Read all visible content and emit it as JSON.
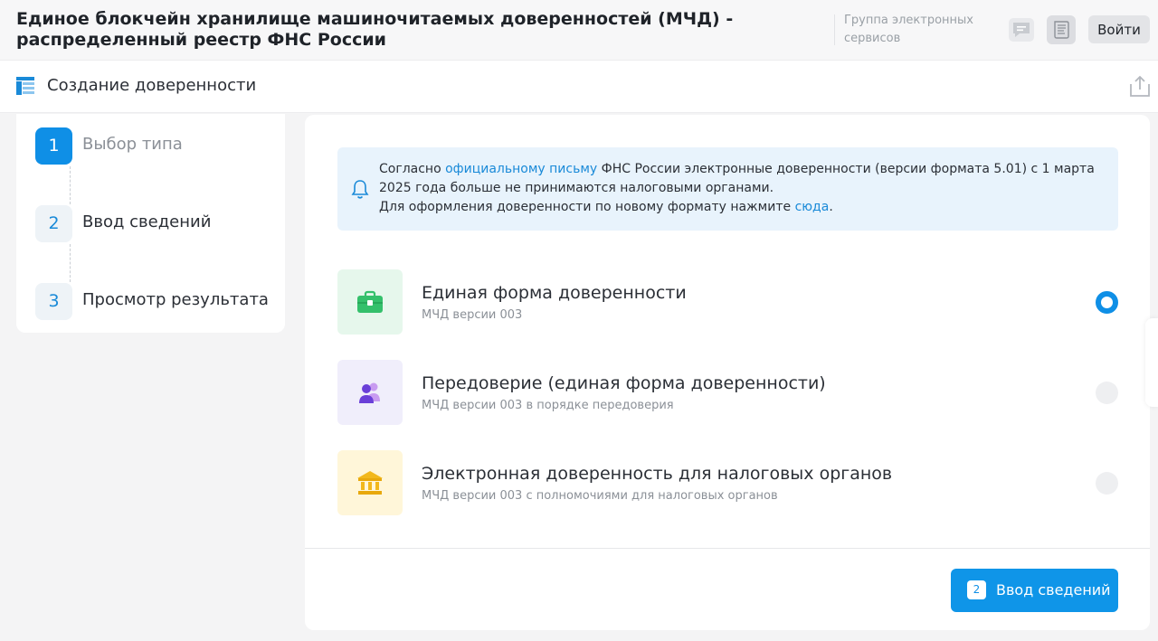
{
  "header": {
    "site_title": "Единое блокчейн хранилище машиночитаемых доверенностей (МЧД) - распределенный реестр ФНС России",
    "group_label": "Группа электронных сервисов",
    "login_label": "Войти"
  },
  "subheader": {
    "title": "Создание доверенности"
  },
  "stepper": {
    "steps": [
      {
        "number": "1",
        "label": "Выбор типа"
      },
      {
        "number": "2",
        "label": "Ввод сведений"
      },
      {
        "number": "3",
        "label": "Просмотр результата"
      }
    ]
  },
  "notice": {
    "line1_a": "Согласно ",
    "line1_link": "официальному письму",
    "line1_b": " ФНС России электронные доверенности (версии формата 5.01) с 1 марта 2025 года больше не принимаются налоговыми органами.",
    "line2_a": "Для оформления доверенности по новому формату нажмите ",
    "line2_link": "сюда",
    "line2_b": "."
  },
  "options": [
    {
      "title": "Единая форма доверенности",
      "subtitle": "МЧД версии 003",
      "selected": true,
      "icon": "briefcase-icon",
      "icon_bg": "#e6f7ec",
      "icon_color": "#34c06b"
    },
    {
      "title": "Передоверие (единая форма доверенности)",
      "subtitle": "МЧД версии 003 в порядке передоверия",
      "selected": false,
      "icon": "users-icon",
      "icon_bg": "#f0eefb",
      "icon_color": "#7a4fe0"
    },
    {
      "title": "Электронная доверенность для налоговых органов",
      "subtitle": "МЧД версии 003 с полномочиями для налоговых органов",
      "selected": false,
      "icon": "bank-icon",
      "icon_bg": "#fff6d9",
      "icon_color": "#f2b81c"
    }
  ],
  "next_button": {
    "step_number": "2",
    "label": "Ввод сведений"
  },
  "colors": {
    "accent": "#0f8fe6",
    "notice_bg": "#e8f3fc"
  }
}
